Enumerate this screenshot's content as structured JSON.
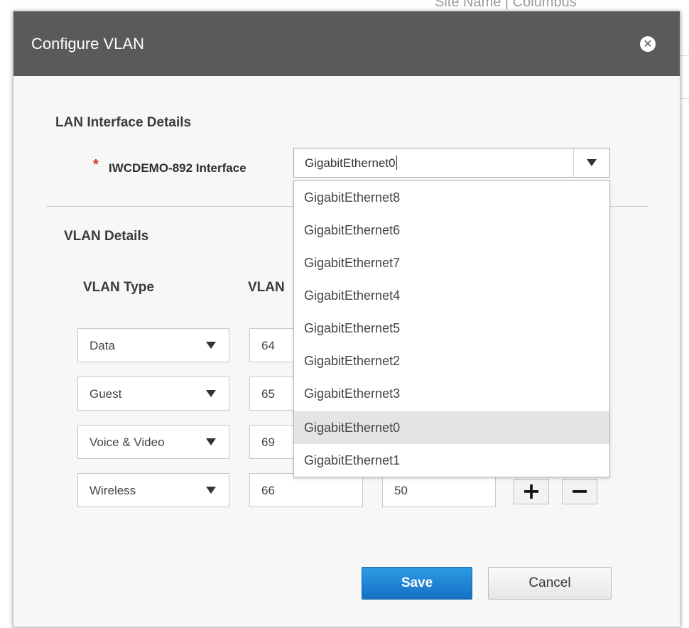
{
  "background": {
    "partial_text": "Site Name   |  Columbus"
  },
  "modal": {
    "title": "Configure VLAN",
    "close_icon": "close-circle-icon"
  },
  "lan_interface": {
    "section_title": "LAN Interface Details",
    "required_marker": "*",
    "label": "IWCDEMO-892 Interface",
    "value": "GigabitEthernet0",
    "options": [
      "GigabitEthernet8",
      "GigabitEthernet6",
      "GigabitEthernet7",
      "GigabitEthernet4",
      "GigabitEthernet5",
      "GigabitEthernet2",
      "GigabitEthernet3",
      "GigabitEthernet0",
      "GigabitEthernet1"
    ],
    "highlighted_option": "GigabitEthernet0"
  },
  "vlan_details": {
    "section_title": "VLAN Details",
    "col_type": "VLAN Type",
    "col_vlan": "VLAN",
    "rows": [
      {
        "type": "Data",
        "vlan_id": "64",
        "third": ""
      },
      {
        "type": "Guest",
        "vlan_id": "65",
        "third": ""
      },
      {
        "type": "Voice & Video",
        "vlan_id": "69",
        "third": ""
      },
      {
        "type": "Wireless",
        "vlan_id": "66",
        "third": "50"
      }
    ],
    "add_label": "+",
    "remove_label": "−"
  },
  "footer": {
    "save_label": "Save",
    "cancel_label": "Cancel"
  },
  "colors": {
    "header_bg": "#5a5a5a",
    "save_bg": "#1f86d6",
    "required": "#d0332d"
  }
}
